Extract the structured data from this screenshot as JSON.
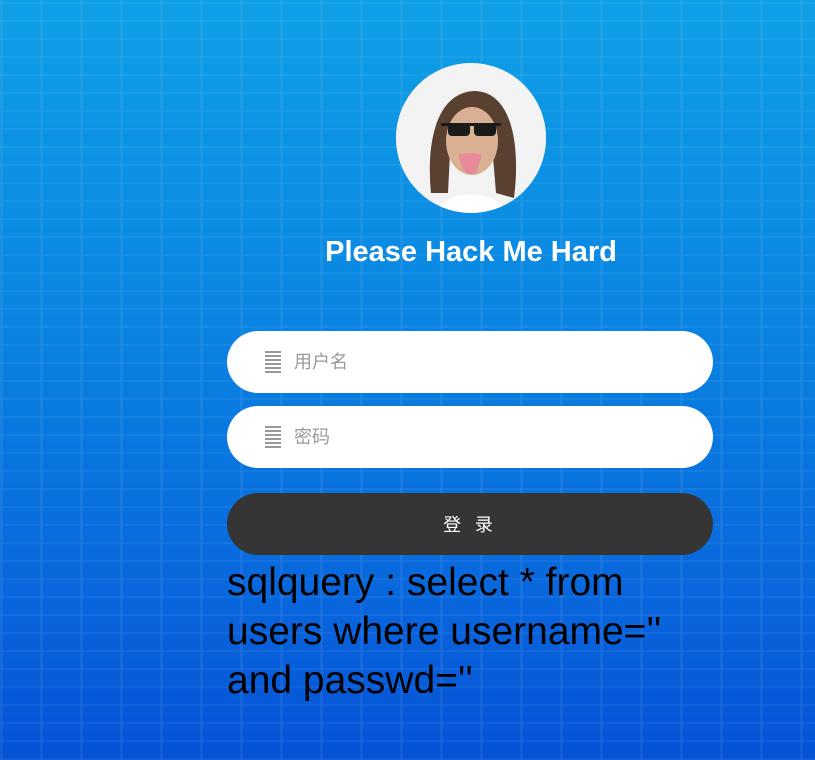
{
  "header": {
    "title": "Please Hack Me Hard",
    "avatar_icon": "user-avatar-photo"
  },
  "form": {
    "username": {
      "value": "",
      "placeholder": "用户名",
      "icon": "list-icon"
    },
    "password": {
      "value": "",
      "placeholder": "密码",
      "icon": "list-icon"
    },
    "submit_label": "登 录"
  },
  "output": {
    "sqlquery": "sqlquery : select * from users where username='' and passwd=''"
  },
  "colors": {
    "button": "#353535",
    "background_top": "#0ea0e6",
    "background_bottom": "#0552d6"
  }
}
